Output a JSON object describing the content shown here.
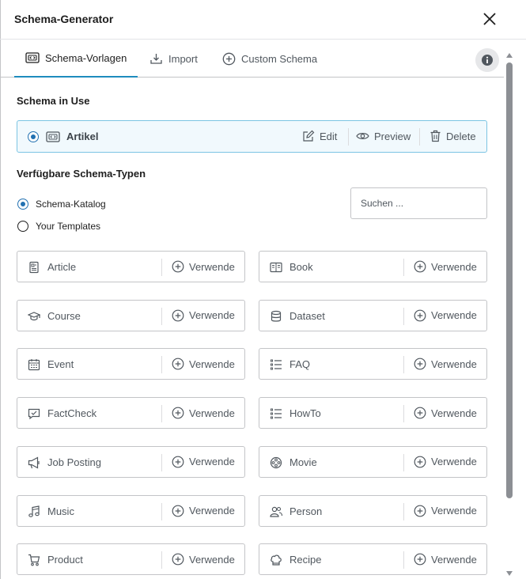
{
  "modal": {
    "title": "Schema-Generator"
  },
  "tabs": [
    {
      "label": "Schema-Vorlagen",
      "icon": "schema-icon",
      "active": true
    },
    {
      "label": "Import",
      "icon": "import-icon",
      "active": false
    },
    {
      "label": "Custom Schema",
      "icon": "plus-circle-icon",
      "active": false
    }
  ],
  "in_use": {
    "heading": "Schema in Use",
    "name": "Artikel",
    "edit_label": "Edit",
    "preview_label": "Preview",
    "delete_label": "Delete"
  },
  "available": {
    "heading": "Verfügbare Schema-Typen",
    "options": [
      {
        "label": "Schema-Katalog",
        "checked": true
      },
      {
        "label": "Your Templates",
        "checked": false
      }
    ],
    "search_placeholder": "Suchen ..."
  },
  "use_label": "Verwende",
  "schemas": [
    {
      "label": "Article",
      "icon": "article-icon"
    },
    {
      "label": "Book",
      "icon": "book-icon"
    },
    {
      "label": "Course",
      "icon": "graduation-cap-icon"
    },
    {
      "label": "Dataset",
      "icon": "database-icon"
    },
    {
      "label": "Event",
      "icon": "calendar-icon"
    },
    {
      "label": "FAQ",
      "icon": "list-icon"
    },
    {
      "label": "FactCheck",
      "icon": "fact-check-icon"
    },
    {
      "label": "HowTo",
      "icon": "list-icon"
    },
    {
      "label": "Job Posting",
      "icon": "megaphone-icon"
    },
    {
      "label": "Movie",
      "icon": "film-reel-icon"
    },
    {
      "label": "Music",
      "icon": "music-note-icon"
    },
    {
      "label": "Person",
      "icon": "people-icon"
    },
    {
      "label": "Product",
      "icon": "cart-icon"
    },
    {
      "label": "Recipe",
      "icon": "chef-hat-icon"
    }
  ],
  "colors": {
    "accent": "#2271b1",
    "active_tab_border": "#1e8cbe",
    "in_use_border": "#7cc4e3",
    "in_use_bg": "#f1f9fd"
  }
}
